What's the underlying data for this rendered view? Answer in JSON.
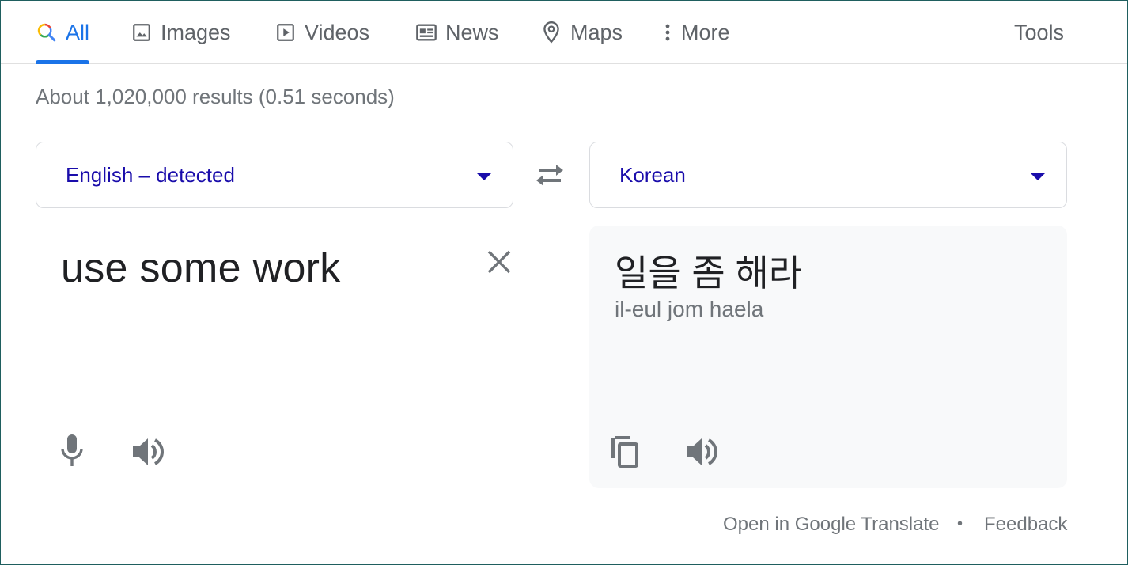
{
  "tabs": [
    {
      "label": "All",
      "icon": "search-icon",
      "active": true
    },
    {
      "label": "Images",
      "icon": "image-icon"
    },
    {
      "label": "Videos",
      "icon": "video-icon"
    },
    {
      "label": "News",
      "icon": "news-icon"
    },
    {
      "label": "Maps",
      "icon": "map-pin-icon"
    },
    {
      "label": "More",
      "icon": "more-vert-icon"
    }
  ],
  "tools_label": "Tools",
  "result_stats": "About 1,020,000 results (0.51 seconds)",
  "translate": {
    "source_language": "English – detected",
    "target_language": "Korean",
    "source_text": "use some work",
    "target_text": "일을 좀 해라",
    "romanization": "il-eul jom haela"
  },
  "footer": {
    "open_link": "Open in Google Translate",
    "separator": "•",
    "feedback": "Feedback"
  },
  "colors": {
    "accent": "#1a73e8",
    "link": "#1a0dab",
    "muted": "#70757a",
    "icon": "#70757a"
  }
}
